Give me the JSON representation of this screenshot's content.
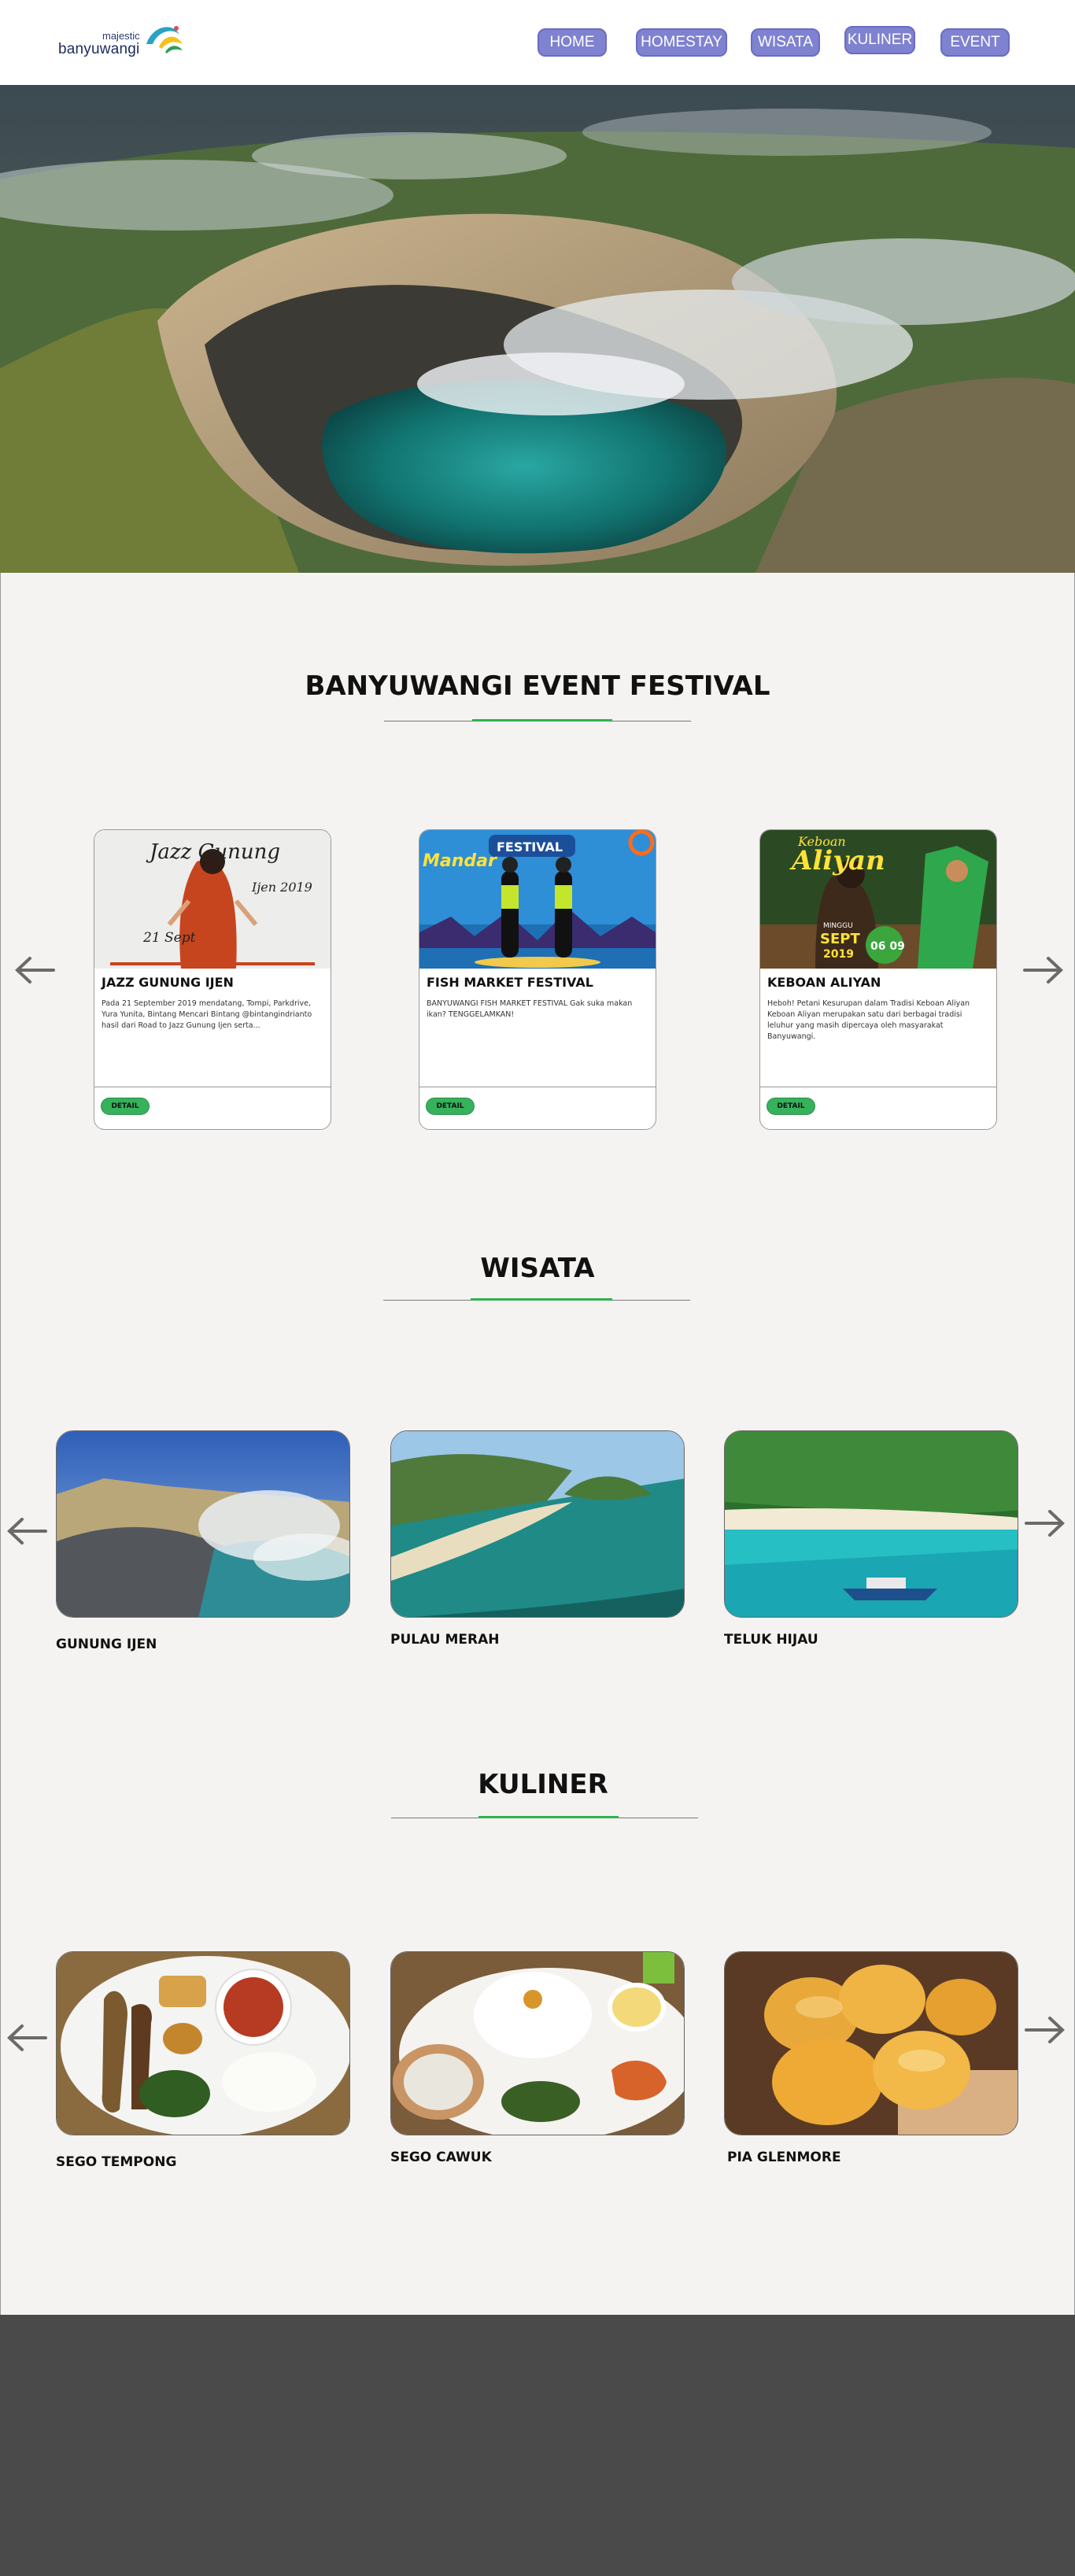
{
  "logo": {
    "small": "majestic",
    "big": "banyuwangi"
  },
  "nav": [
    "HOME",
    "HOMESTAY",
    "WISATA",
    "KULINER",
    "EVENT"
  ],
  "events": {
    "title": "BANYUWANGI EVENT FESTIVAL",
    "cards": [
      {
        "title": "JAZZ GUNUNG IJEN",
        "desc": "Pada 21 September 2019 mendatang, Tompi, Parkdrive, Yura Yunita, Bintang Mencari Bintang @bintangindrianto hasil dari Road to Jazz Gunung Ijen serta...",
        "img_text": {
          "script": "Jazz Gunung",
          "year": "Ijen 2019",
          "date": "21 Sept"
        },
        "button": "DETAIL"
      },
      {
        "title": "FISH MARKET FESTIVAL",
        "desc": "BANYUWANGI FISH MARKET FESTIVAL Gak suka makan ikan? TENGGELAMKAN!",
        "img_text": {
          "brand": "Mandar",
          "banner": "FESTIVAL"
        },
        "button": "DETAIL"
      },
      {
        "title": "KEBOAN ALIYAN",
        "desc": "Heboh! Petani Kesurupan dalam Tradisi Keboan Aliyan Keboan Aliyan merupakan satu dari berbagai tradisi leluhur yang masih dipercaya oleh masyarakat Banyuwangi.",
        "img_text": {
          "top": "Keboan",
          "main": "Aliyan",
          "day": "MINGGU",
          "month": "SEPT",
          "year": "2019",
          "dates": "06 09"
        },
        "button": "DETAIL"
      }
    ]
  },
  "wisata": {
    "title": "WISATA",
    "items": [
      "GUNUNG IJEN",
      "PULAU MERAH",
      "TELUK HIJAU"
    ]
  },
  "kuliner": {
    "title": "KULINER",
    "items": [
      "SEGO TEMPONG",
      "SEGO CAWUK",
      "PIA GLENMORE"
    ]
  },
  "colors": {
    "nav": "#7f82d0",
    "accent": "#2fb24c",
    "detail": "#36b15c",
    "footer": "#4a4a4a",
    "page": "#f4f3f1"
  },
  "icons": [
    "arrow-left-icon",
    "arrow-right-icon"
  ]
}
